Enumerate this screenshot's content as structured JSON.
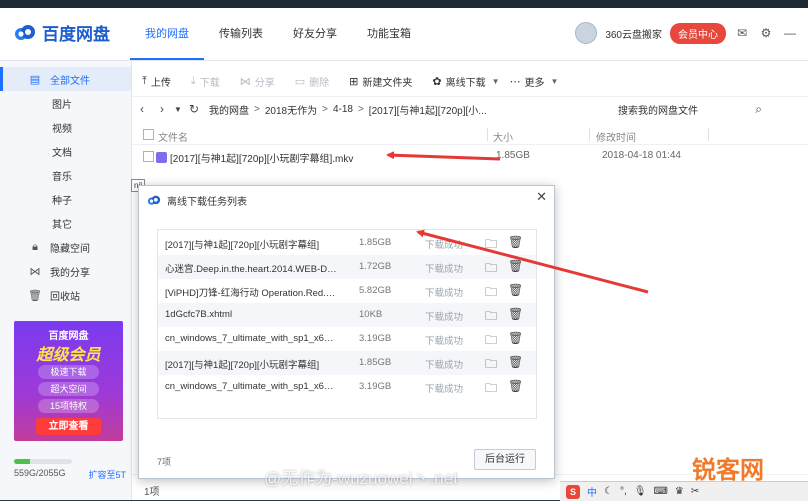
{
  "app": {
    "name": "百度网盘",
    "nav_tabs": [
      "我的网盘",
      "传输列表",
      "好友分享",
      "功能宝箱"
    ],
    "user_name": "360云盘搬家",
    "vip_label": "会员中心"
  },
  "sidebar": {
    "items": [
      {
        "label": "全部文件",
        "icon": "file-icon",
        "active": true
      },
      {
        "label": "图片",
        "sub": true
      },
      {
        "label": "视频",
        "sub": true
      },
      {
        "label": "文档",
        "sub": true
      },
      {
        "label": "音乐",
        "sub": true
      },
      {
        "label": "种子",
        "sub": true
      },
      {
        "label": "其它",
        "sub": true
      },
      {
        "label": "隐藏空间",
        "icon": "lock-icon"
      },
      {
        "label": "我的分享",
        "icon": "share-icon"
      },
      {
        "label": "回收站",
        "icon": "trash-icon"
      }
    ],
    "banner": {
      "line1": "百度网盘",
      "line2": "超级会员",
      "perks": [
        "极速下载",
        "超大空间",
        "15项特权"
      ],
      "cta": "立即查看"
    },
    "quota": {
      "text": "559G/2055G",
      "fraction": 0.272,
      "expand": "扩容至5T"
    }
  },
  "toolbar": {
    "upload": "上传",
    "download": "下载",
    "share": "分享",
    "delete": "删除",
    "new_folder": "新建文件夹",
    "offline": "离线下载",
    "more": "更多"
  },
  "path": {
    "crumbs": [
      "我的网盘",
      "2018无作为",
      "4-18",
      "[2017][与神1起][720p][小..."
    ],
    "search_label": "搜索我的网盘文件"
  },
  "list": {
    "headers": {
      "name": "文件名",
      "size": "大小",
      "date": "修改时间"
    },
    "files": [
      {
        "name": "[2017][与神1起][720p][小玩剧字幕组].mkv",
        "size": "1.85GB",
        "date": "2018-04-18 01:44"
      }
    ]
  },
  "status": {
    "count": "1项"
  },
  "tooltip": {
    "text": "nil"
  },
  "dialog": {
    "title": "离线下载任务列表",
    "tasks": [
      {
        "name": "[2017][与神1起][720p][小玩剧字幕组]",
        "size": "1.85GB",
        "status": "下载成功"
      },
      {
        "name": "心迷宫.Deep.in.the.heart.2014.WEB-DL.…",
        "size": "1.72GB",
        "status": "下载成功"
      },
      {
        "name": "[ViPHD]刀锋-红海行动 Operation.Red.S…",
        "size": "5.82GB",
        "status": "下载成功"
      },
      {
        "name": "1dGcfc7B.xhtml",
        "size": "10KB",
        "status": "下载成功"
      },
      {
        "name": "cn_windows_7_ultimate_with_sp1_x64_…",
        "size": "3.19GB",
        "status": "下载成功"
      },
      {
        "name": "[2017][与神1起][720p][小玩剧字幕组]",
        "size": "1.85GB",
        "status": "下载成功"
      },
      {
        "name": "cn_windows_7_ultimate_with_sp1_x64_…",
        "size": "3.19GB",
        "status": "下载成功"
      }
    ],
    "count": "7项",
    "bg_button": "后台运行"
  },
  "watermark": {
    "text": "@无作为-wuzuowei丶.net",
    "site": "锐客网"
  },
  "ime": {
    "logo": "S",
    "lang": "中"
  },
  "colors": {
    "accent": "#1e6fff",
    "vip": "#e8473c",
    "arrow": "#e53935"
  }
}
